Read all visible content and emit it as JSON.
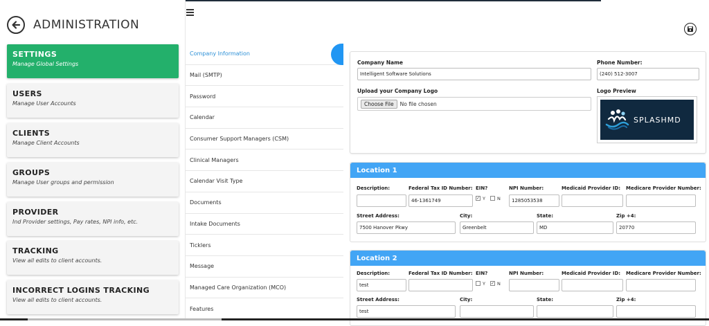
{
  "header": {
    "title": "ADMINISTRATION"
  },
  "sidebar": {
    "items": [
      {
        "title": "SETTINGS",
        "subtitle": "Manage Global Settings",
        "active": true
      },
      {
        "title": "USERS",
        "subtitle": "Manage User Accounts",
        "active": false
      },
      {
        "title": "CLIENTS",
        "subtitle": "Manage Client Accounts",
        "active": false
      },
      {
        "title": "GROUPS",
        "subtitle": "Manage User groups and permission",
        "active": false
      },
      {
        "title": "PROVIDER",
        "subtitle": "Ind Provider settings, Pay rates, NPI info, etc.",
        "active": false
      },
      {
        "title": "TRACKING",
        "subtitle": "View all edits to client accounts.",
        "active": false
      },
      {
        "title": "INCORRECT LOGINS TRACKING",
        "subtitle": "View all edits to client accounts.",
        "active": false
      }
    ]
  },
  "menu": {
    "items": [
      "Company Information",
      "Mail (SMTP)",
      "Password",
      "Calendar",
      "Consumer Support Managers (CSM)",
      "Clinical Managers",
      "Calendar Visit Type",
      "Documents",
      "Intake Documents",
      "Ticklers",
      "Message",
      "Managed Care Organization (MCO)",
      "Features"
    ],
    "active_index": 0
  },
  "company": {
    "name_label": "Company Name",
    "name_value": "Intelligent Software Solutions",
    "phone_label": "Phone Number:",
    "phone_value": "(240) 512-3007",
    "logo_upload_label": "Upload your Company Logo",
    "file_button": "Choose File",
    "file_status": "No file chosen",
    "logo_preview_label": "Logo Preview",
    "logo_text": "SPLASHMD"
  },
  "location_labels": {
    "description": "Description:",
    "tax_id": "Federal Tax ID Number:",
    "ein": "EIN?",
    "ein_yes": "Y",
    "ein_no": "N",
    "npi": "NPI Number:",
    "medicaid": "Medicaid Provider ID:",
    "medicare": "Medicare Provider Number:",
    "street": "Street Address:",
    "city": "City:",
    "state": "State:",
    "zip": "Zip +4:"
  },
  "locations": [
    {
      "title": "Location 1",
      "description": "",
      "tax_id": "46-1361749",
      "ein_yes": true,
      "ein_no": false,
      "npi": "1285053538",
      "medicaid": "",
      "medicare": "",
      "street": "7500 Hanover Pkwy",
      "city": "Greenbelt",
      "state": "MD",
      "zip": "20770"
    },
    {
      "title": "Location 2",
      "description": "test",
      "tax_id": "",
      "ein_yes": false,
      "ein_no": true,
      "npi": "",
      "medicaid": "",
      "medicare": "",
      "street": "test",
      "city": "",
      "state": "",
      "zip": ""
    }
  ],
  "colors": {
    "active_card": "#23b06b",
    "location_header": "#42a5f5",
    "menu_active": "#2b8fd6"
  },
  "icons": {
    "back": "arrow-left-icon",
    "menu": "hamburger-icon",
    "save": "save-icon"
  }
}
